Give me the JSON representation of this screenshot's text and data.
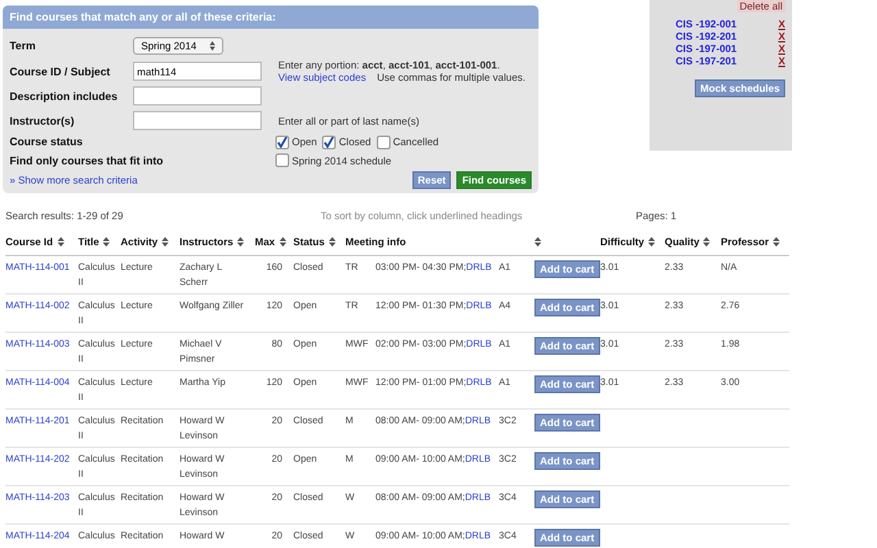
{
  "search_form": {
    "title": "Find courses that match any or all of these criteria:",
    "term": {
      "label": "Term",
      "value": "Spring 2014"
    },
    "course_id": {
      "label": "Course ID / Subject",
      "value": "math114",
      "hint": "Enter any portion: **acct**, **acct-101**, **acct-101-001**.",
      "link": "View subject codes",
      "note": "Use commas for multiple values."
    },
    "description": {
      "label": "Description includes"
    },
    "instructor": {
      "label": "Instructor(s)",
      "hint": "Enter all or part of last name(s)"
    },
    "status": {
      "label": "Course status",
      "options": [
        {
          "label": "Open",
          "checked": true
        },
        {
          "label": "Closed",
          "checked": true
        },
        {
          "label": "Cancelled",
          "checked": false
        }
      ]
    },
    "fit_into": {
      "label": "Find only courses that fit into",
      "option": {
        "label": "Spring 2014 schedule",
        "checked": false
      }
    },
    "more_link": "» Show more search criteria",
    "reset": "Reset",
    "submit": "Find courses"
  },
  "cart": {
    "delete_all": "Delete all",
    "items": [
      {
        "code": "CIS -192-001",
        "remove": "X"
      },
      {
        "code": "CIS -192-201",
        "remove": "X"
      },
      {
        "code": "CIS -197-001",
        "remove": "X"
      },
      {
        "code": "CIS -197-201",
        "remove": "X"
      }
    ],
    "mock": "Mock schedules"
  },
  "results": {
    "summary": "Search results: 1-29 of 29",
    "sort_hint": "To sort by column, click underlined headings",
    "pages": "Pages: 1"
  },
  "table": {
    "columns": [
      {
        "kind": "label",
        "label": "Course Id"
      },
      {
        "kind": "label",
        "label": "Title"
      },
      {
        "kind": "label",
        "label": "Activity"
      },
      {
        "kind": "label",
        "label": "Instructors"
      },
      {
        "kind": "label",
        "label": "Max"
      },
      {
        "kind": "label",
        "label": "Status"
      },
      {
        "kind": "group",
        "label": "Meeting info"
      },
      {
        "kind": "sort"
      },
      {
        "kind": "label",
        "label": "Difficulty"
      },
      {
        "kind": "label",
        "label": "Quality"
      },
      {
        "kind": "label",
        "label": "Professor"
      }
    ],
    "rows": [
      {
        "id": "MATH-114-001",
        "title": "Calculus II",
        "activity": "Lecture",
        "instructor": "Zachary L Scherr",
        "max": "160",
        "status": "Closed",
        "days": "TR",
        "time": "03:00 PM- 04:30 PM;",
        "building": "DRLB",
        "room": "A1",
        "cart": "Add to cart",
        "difficulty": "3.01",
        "quality": "2.33",
        "professor": "N/A"
      },
      {
        "id": "MATH-114-002",
        "title": "Calculus II",
        "activity": "Lecture",
        "instructor": "Wolfgang Ziller",
        "max": "120",
        "status": "Open",
        "days": "TR",
        "time": "12:00 PM- 01:30 PM;",
        "building": "DRLB",
        "room": "A4",
        "cart": "Add to cart",
        "difficulty": "3.01",
        "quality": "2.33",
        "professor": "2.76"
      },
      {
        "id": "MATH-114-003",
        "title": "Calculus II",
        "activity": "Lecture",
        "instructor": "Michael V Pimsner",
        "max": "80",
        "status": "Open",
        "days": "MWF",
        "time": "02:00 PM- 03:00 PM;",
        "building": "DRLB",
        "room": "A1",
        "cart": "Add to cart",
        "difficulty": "3.01",
        "quality": "2.33",
        "professor": "1.98"
      },
      {
        "id": "MATH-114-004",
        "title": "Calculus II",
        "activity": "Lecture",
        "instructor": "Martha Yip",
        "max": "120",
        "status": "Open",
        "days": "MWF",
        "time": "12:00 PM- 01:00 PM;",
        "building": "DRLB",
        "room": "A1",
        "cart": "Add to cart",
        "difficulty": "3.01",
        "quality": "2.33",
        "professor": "3.00"
      },
      {
        "id": "MATH-114-201",
        "title": "Calculus II",
        "activity": "Recitation",
        "instructor": "Howard W Levinson",
        "max": "20",
        "status": "Closed",
        "days": "M",
        "time": "08:00 AM- 09:00 AM;",
        "building": "DRLB",
        "room": "3C2",
        "cart": "Add to cart"
      },
      {
        "id": "MATH-114-202",
        "title": "Calculus II",
        "activity": "Recitation",
        "instructor": "Howard W Levinson",
        "max": "20",
        "status": "Open",
        "days": "M",
        "time": "09:00 AM- 10:00 AM;",
        "building": "DRLB",
        "room": "3C2",
        "cart": "Add to cart"
      },
      {
        "id": "MATH-114-203",
        "title": "Calculus II",
        "activity": "Recitation",
        "instructor": "Howard W Levinson",
        "max": "20",
        "status": "Closed",
        "days": "W",
        "time": "08:00 AM- 09:00 AM;",
        "building": "DRLB",
        "room": "3C4",
        "cart": "Add to cart"
      },
      {
        "id": "MATH-114-204",
        "title": "Calculus",
        "activity": "Recitation",
        "instructor": "Howard W",
        "max": "20",
        "status": "Closed",
        "days": "W",
        "time": "09:00 AM- 10:00 AM;",
        "building": "DRLB",
        "room": "3C4",
        "cart": "Add to cart"
      }
    ]
  }
}
